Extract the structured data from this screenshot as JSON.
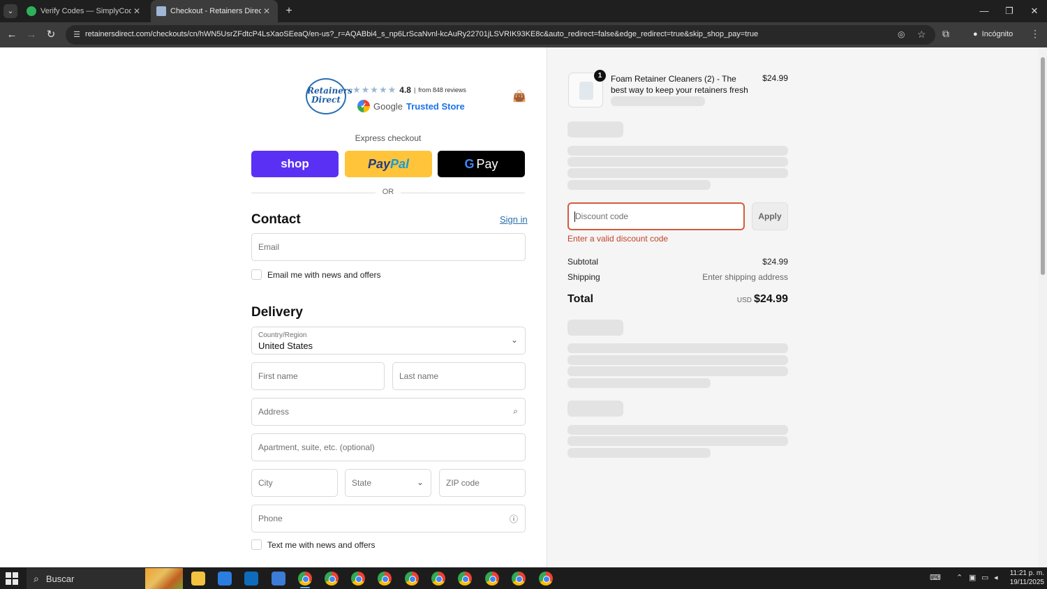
{
  "browser": {
    "tabs": [
      {
        "title": "Verify Codes — SimplyCodes",
        "active": false,
        "icon": "simplycodes-icon"
      },
      {
        "title": "Checkout - Retainers Direct",
        "active": true,
        "icon": "page-icon"
      }
    ],
    "url": "retainersdirect.com/checkouts/cn/hWN5UsrZFdtcP4LsXaoSEeaQ/en-us?_r=AQABbi4_s_np6LrScaNvnl-kcAuRy22701jLSVRIK93KE8c&auto_redirect=false&edge_redirect=true&skip_shop_pay=true",
    "incognito_label": "Incógnito"
  },
  "header": {
    "logo_text": "Retainers Direct",
    "rating": "4.8",
    "reviews": "from 848 reviews",
    "trusted_google": "Google",
    "trusted_store": "Trusted Store"
  },
  "express": {
    "title": "Express checkout",
    "shop_label": "shop",
    "paypal_pay": "Pay",
    "paypal_pal": "Pal",
    "gpay_g": "G",
    "gpay_label": "Pay",
    "or_label": "OR"
  },
  "contact": {
    "heading": "Contact",
    "signin": "Sign in",
    "email_placeholder": "Email",
    "news_label": "Email me with news and offers"
  },
  "delivery": {
    "heading": "Delivery",
    "country_label": "Country/Region",
    "country_value": "United States",
    "first_name": "First name",
    "last_name": "Last name",
    "address": "Address",
    "apartment": "Apartment, suite, etc. (optional)",
    "city": "City",
    "state": "State",
    "zip": "ZIP code",
    "phone": "Phone",
    "text_label": "Text me with news and offers"
  },
  "order": {
    "quantity": "1",
    "product_name": "Foam Retainer Cleaners (2) - The best way to keep your retainers fresh",
    "product_price": "$24.99",
    "discount_placeholder": "Discount code",
    "apply_label": "Apply",
    "error": "Enter a valid discount code",
    "subtotal_label": "Subtotal",
    "subtotal_value": "$24.99",
    "shipping_label": "Shipping",
    "shipping_value": "Enter shipping address",
    "total_label": "Total",
    "currency": "USD",
    "total_value": "$24.99"
  },
  "taskbar": {
    "search_label": "Buscar",
    "time": "11:21 p. m.",
    "date": "19/11/2025"
  },
  "colors": {
    "shop_purple": "#5a31f4",
    "paypal_yellow": "#ffc439",
    "error_red": "#c0442a",
    "link_blue": "#2a6fb0"
  }
}
